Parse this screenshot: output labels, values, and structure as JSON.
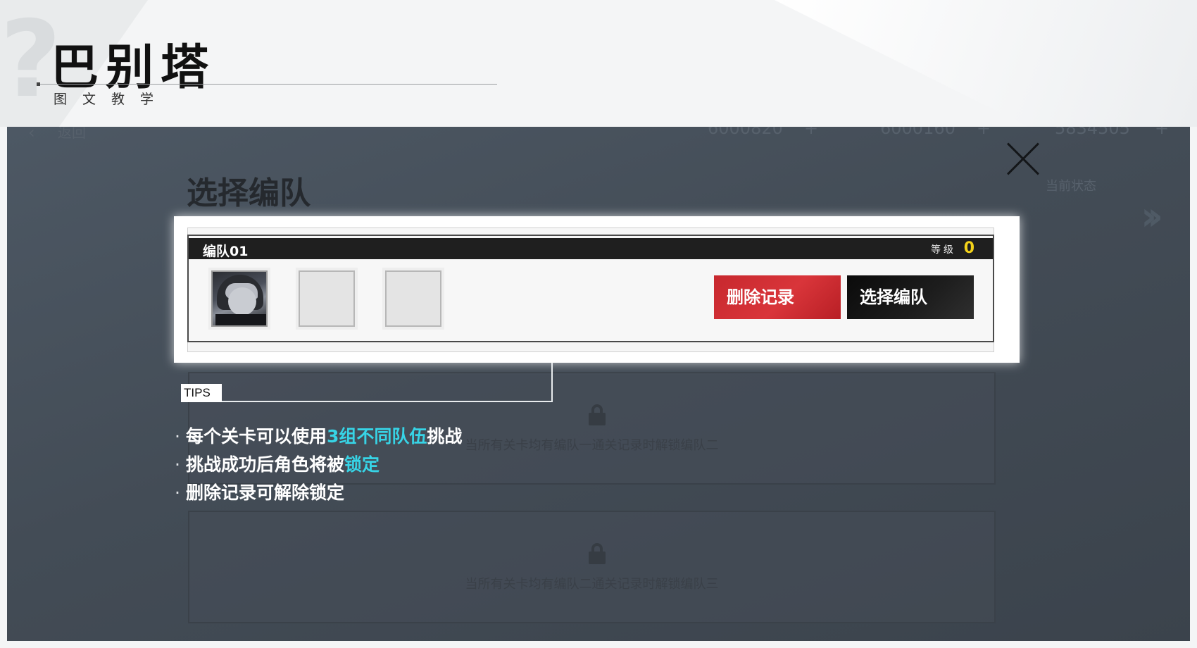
{
  "header": {
    "title": "巴别塔",
    "subtitle": "图文教学"
  },
  "game": {
    "topbar": {
      "back_label": "返回",
      "currency_1": "6000820",
      "currency_2": "6000160",
      "currency_3": "5834505",
      "plus": "+",
      "right_label": "当前状态"
    },
    "section_title": "选择编队",
    "team": {
      "name": "编队01",
      "level_label": "等级",
      "level_value": "0",
      "delete_button": "删除记录",
      "select_button": "选择编队"
    },
    "locked_slots": [
      {
        "text": "当所有关卡均有编队一通关记录时解锁编队二"
      },
      {
        "text": "当所有关卡均有编队二通关记录时解锁编队三"
      }
    ]
  },
  "tips": {
    "label": "TIPS",
    "items": [
      {
        "prefix": "每个关卡可以使用",
        "highlight": "3组不同队伍",
        "suffix": "挑战"
      },
      {
        "prefix": "挑战成功后角色将被",
        "highlight": "锁定",
        "suffix": ""
      },
      {
        "prefix": "删除记录可解除锁定",
        "highlight": "",
        "suffix": ""
      }
    ],
    "bullet": "·"
  },
  "colors": {
    "highlight": "#37d4e6",
    "delete_button": "#c7282e",
    "select_button": "#111111",
    "level_value": "#f3d21a"
  },
  "icons": {
    "close": "close-icon",
    "lock": "lock-icon",
    "chevron": "double-chevron-right-icon"
  }
}
